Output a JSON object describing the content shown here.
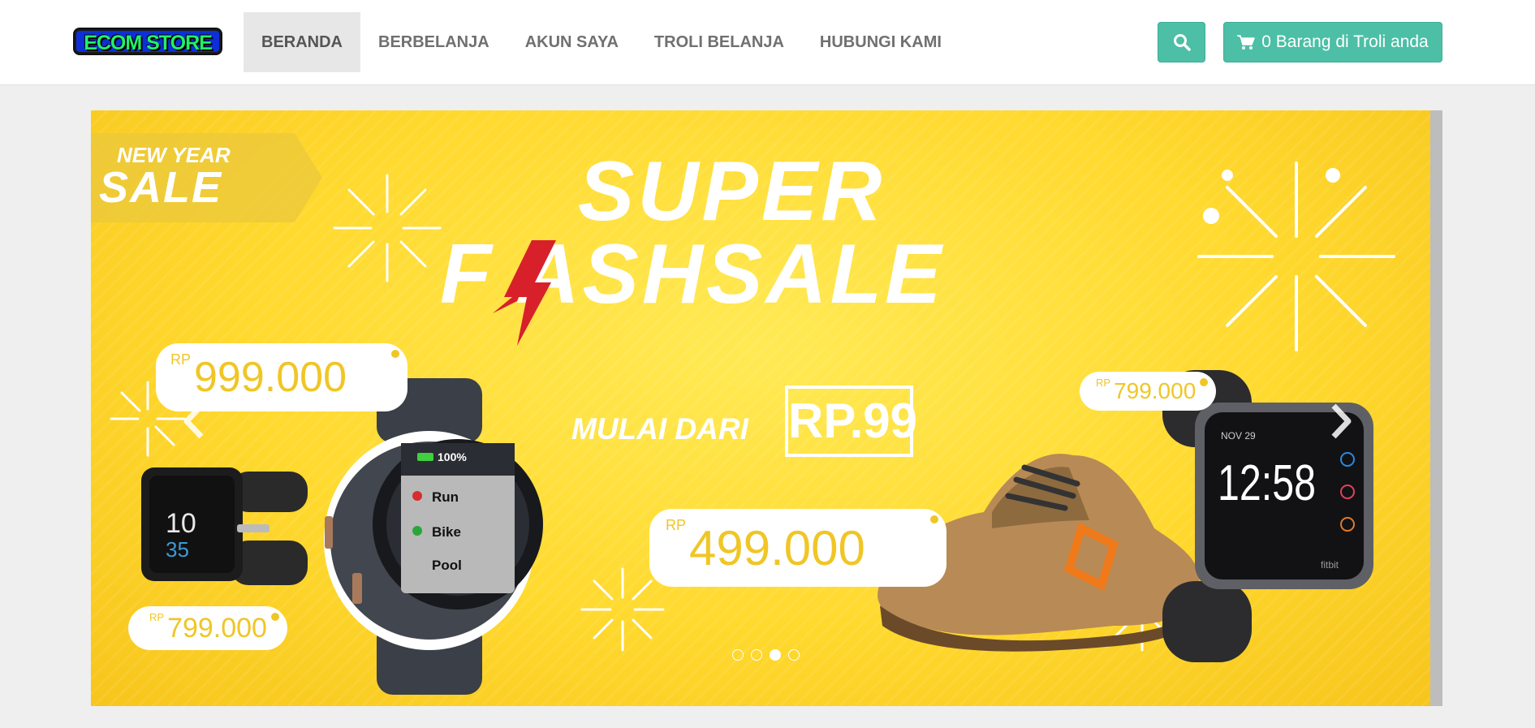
{
  "navbar": {
    "logo_text": "ECOM STORE",
    "items": [
      {
        "label": "BERANDA",
        "active": true
      },
      {
        "label": "BERBELANJA",
        "active": false
      },
      {
        "label": "AKUN SAYA",
        "active": false
      },
      {
        "label": "TROLI BELANJA",
        "active": false
      },
      {
        "label": "HUBUNGI KAMI",
        "active": false
      }
    ],
    "search_icon": "search-icon",
    "cart_icon": "shopping-cart-icon",
    "cart_label": "0 Barang di Troli anda",
    "accent_color": "#4cbfa6"
  },
  "carousel": {
    "banner": {
      "ribbon_small": "NEW YEAR",
      "ribbon_big": "SALE",
      "headline_line1": "SUPER",
      "headline_line2": "F  ASHSALE",
      "promo_label": "MULAI DARI",
      "promo_price": "RP.99",
      "price_tags": [
        {
          "currency": "RP",
          "amount": "999.000"
        },
        {
          "currency": "RP",
          "amount": "799.000"
        },
        {
          "currency": "RP",
          "amount": "499.000"
        },
        {
          "currency": "RP",
          "amount": "799.000"
        }
      ],
      "watch_face": {
        "battery": "100%",
        "activity_1": "Run",
        "activity_2": "Bike",
        "activity_3": "Pool"
      },
      "fitbit_face": {
        "date": "NOV 29",
        "time": "12:58",
        "brand": "fitbit"
      },
      "sony_face": {
        "hour": "10",
        "minute": "35"
      },
      "background_color": "#ffd92e"
    },
    "prev_icon": "chevron-left-icon",
    "next_icon": "chevron-right-icon",
    "indicator_count": 4,
    "active_indicator": 3
  }
}
